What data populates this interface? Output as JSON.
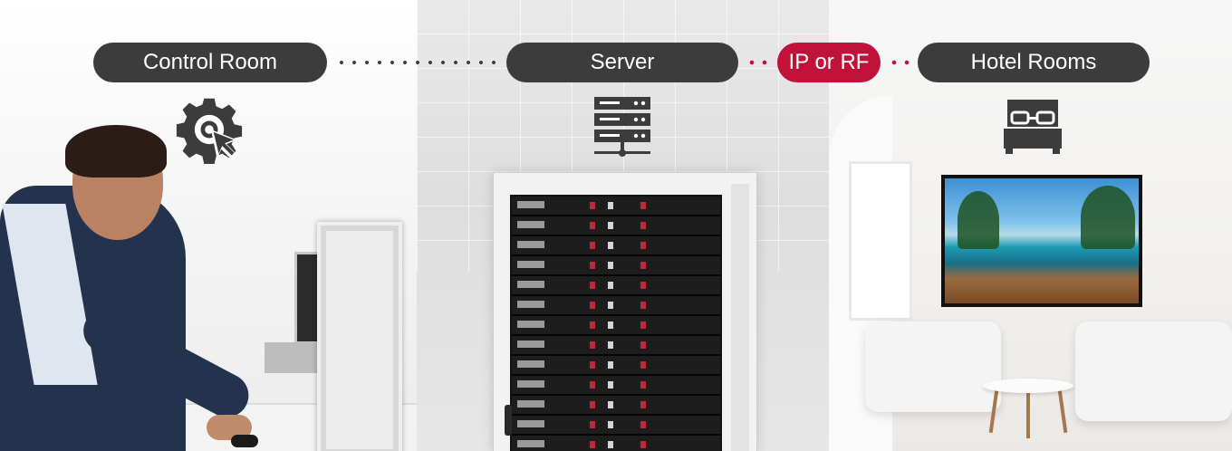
{
  "steps": [
    {
      "label": "Control Room",
      "icon": "gear-cursor-icon"
    },
    {
      "label": "Server",
      "icon": "server-icon"
    },
    {
      "label": "Hotel Rooms",
      "icon": "bed-icon"
    }
  ],
  "connection": {
    "label": "IP or RF"
  },
  "colors": {
    "pill_dark": "#3c3c3c",
    "accent_red": "#c1133a",
    "icon_dark": "#3c3c3c"
  }
}
